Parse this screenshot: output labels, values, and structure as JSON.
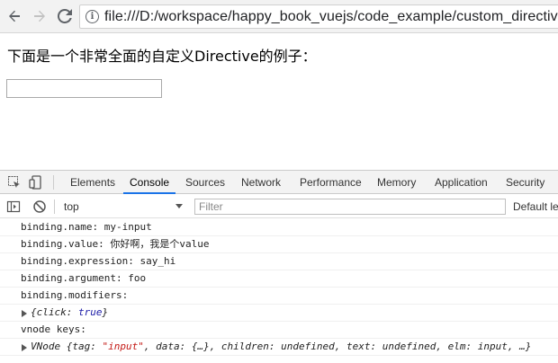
{
  "browser": {
    "url": "file:///D:/workspace/happy_book_vuejs/code_example/custom_directive/an"
  },
  "page": {
    "heading": "下面是一个非常全面的自定义Directive的例子："
  },
  "devtools": {
    "tabs": [
      "Elements",
      "Console",
      "Sources",
      "Network",
      "Performance",
      "Memory",
      "Application",
      "Security"
    ],
    "active_tab": "Console",
    "context": "top",
    "filter_placeholder": "Filter",
    "levels_label": "Default le"
  },
  "console": {
    "lines": [
      "binding.name: my-input",
      "binding.value: 你好啊，我是个value",
      "binding.expression: say_hi",
      "binding.argument: foo",
      "binding.modifiers:",
      "vnode keys:"
    ],
    "modifiers_obj": {
      "prefix": "{click: ",
      "value": "true",
      "suffix": "}"
    },
    "vnode_obj": {
      "prefix": "VNode {tag: ",
      "tag_value": "\"input\"",
      "rest": ", data: {…}, children: undefined, text: undefined, elm: input, …}"
    }
  }
}
